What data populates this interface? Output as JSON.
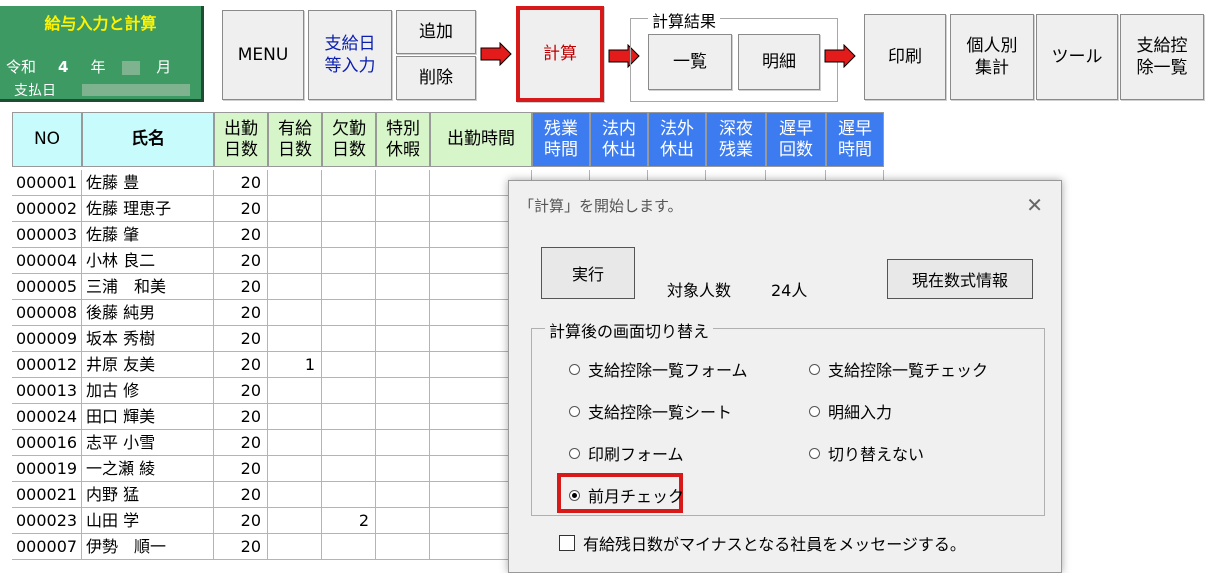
{
  "title_panel": {
    "title": "給与入力と計算",
    "era": "令和",
    "year_num": "4",
    "year_unit": "年",
    "month_unit": "月",
    "payday_label": "支払日"
  },
  "toolbar": {
    "menu": "MENU",
    "pay_date_line1": "支給日",
    "pay_date_line2": "等入力",
    "add": "追加",
    "delete": "削除",
    "calc": "計算",
    "result_group": "計算結果",
    "list": "一覧",
    "detail": "明細",
    "print": "印刷",
    "individual_line1": "個人別",
    "individual_line2": "集計",
    "tools": "ツール",
    "deduction_line1": "支給控",
    "deduction_line2": "除一覧",
    "arrow_color": "#e31b1b"
  },
  "table": {
    "headers": {
      "no": "NO",
      "name": "氏名",
      "work_days_1": "出勤",
      "work_days_2": "日数",
      "paid_1": "有給",
      "paid_2": "日数",
      "absent_1": "欠勤",
      "absent_2": "日数",
      "special_1": "特別",
      "special_2": "休暇",
      "work_hours": "出勤時間",
      "ot_1": "残業",
      "ot_2": "時間",
      "legal_1": "法内",
      "legal_2": "休出",
      "extra_1": "法外",
      "extra_2": "休出",
      "night_1": "深夜",
      "night_2": "残業",
      "late_1": "遅早",
      "late_2": "回数",
      "latehr_1": "遅早",
      "latehr_2": "時間"
    },
    "rows": [
      {
        "no": "000001",
        "name": "佐藤 豊",
        "days": "20",
        "paid": "",
        "absent": ""
      },
      {
        "no": "000002",
        "name": "佐藤 理恵子",
        "days": "20",
        "paid": "",
        "absent": ""
      },
      {
        "no": "000003",
        "name": "佐藤 肇",
        "days": "20",
        "paid": "",
        "absent": ""
      },
      {
        "no": "000004",
        "name": "小林 良二",
        "days": "20",
        "paid": "",
        "absent": ""
      },
      {
        "no": "000005",
        "name": "三浦　和美",
        "days": "20",
        "paid": "",
        "absent": ""
      },
      {
        "no": "000008",
        "name": "後藤 純男",
        "days": "20",
        "paid": "",
        "absent": ""
      },
      {
        "no": "000009",
        "name": "坂本 秀樹",
        "days": "20",
        "paid": "",
        "absent": ""
      },
      {
        "no": "000012",
        "name": "井原 友美",
        "days": "20",
        "paid": "1",
        "absent": ""
      },
      {
        "no": "000013",
        "name": "加古 修",
        "days": "20",
        "paid": "",
        "absent": ""
      },
      {
        "no": "000024",
        "name": "田口 輝美",
        "days": "20",
        "paid": "",
        "absent": ""
      },
      {
        "no": "000016",
        "name": "志平 小雪",
        "days": "20",
        "paid": "",
        "absent": ""
      },
      {
        "no": "000019",
        "name": "一之瀬 綾",
        "days": "20",
        "paid": "",
        "absent": ""
      },
      {
        "no": "000021",
        "name": "内野 猛",
        "days": "20",
        "paid": "",
        "absent": ""
      },
      {
        "no": "000023",
        "name": "山田 学",
        "days": "20",
        "paid": "",
        "absent": "2"
      },
      {
        "no": "000007",
        "name": "伊勢　順一",
        "days": "20",
        "paid": "",
        "absent": ""
      }
    ]
  },
  "dialog": {
    "title": "「計算」を開始します。",
    "run": "実行",
    "target_label": "対象人数",
    "target_count": "24人",
    "formula_info": "現在数式情報",
    "switch_group": "計算後の画面切り替え",
    "options": {
      "o1": "支給控除一覧フォーム",
      "o2": "支給控除一覧チェック",
      "o3": "支給控除一覧シート",
      "o4": "明細入力",
      "o5": "印刷フォーム",
      "o6": "切り替えない",
      "o7": "前月チェック"
    },
    "selected_option": "前月チェック",
    "checkbox_label": "有給残日数がマイナスとなる社員をメッセージする。",
    "checkbox_checked": false
  }
}
